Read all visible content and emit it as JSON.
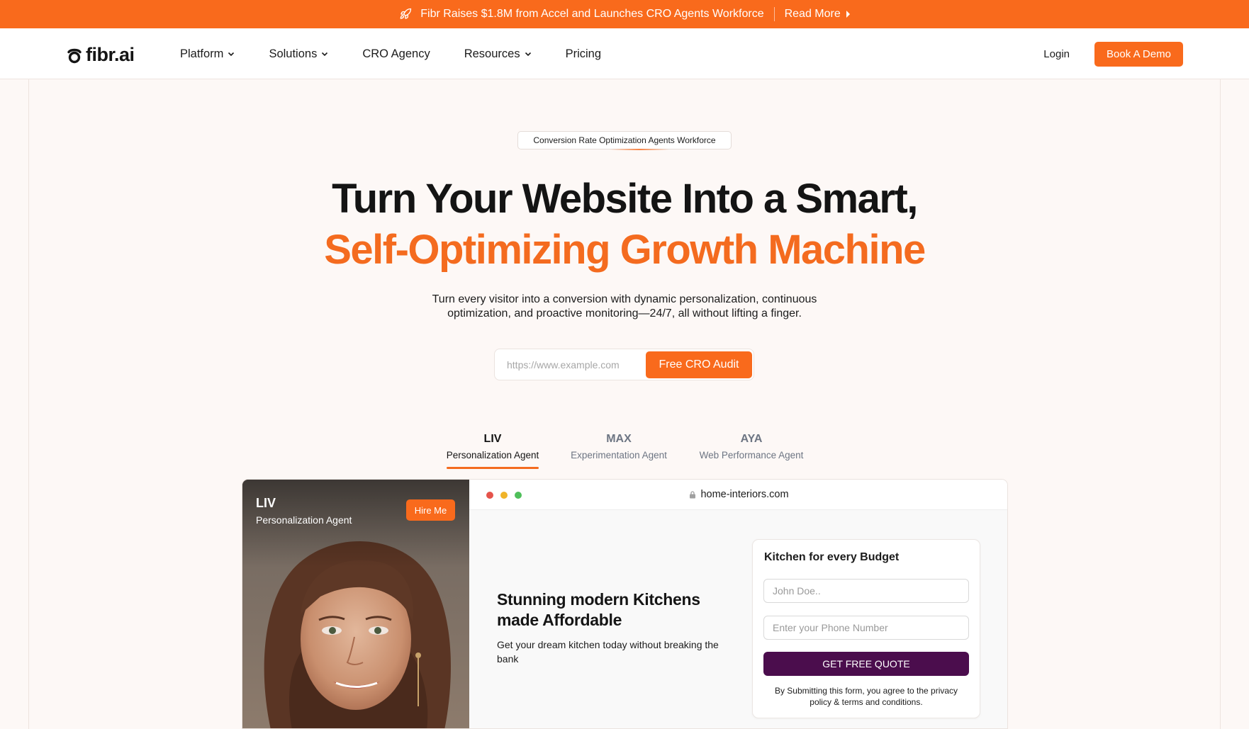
{
  "announcement": {
    "text": "Fibr Raises $1.8M from Accel and Launches CRO Agents Workforce",
    "link": "Read More",
    "icon": "rocket-icon"
  },
  "nav": {
    "logo": "fibr.ai",
    "items": [
      {
        "label": "Platform",
        "dropdown": true
      },
      {
        "label": "Solutions",
        "dropdown": true
      },
      {
        "label": "CRO Agency",
        "dropdown": false
      },
      {
        "label": "Resources",
        "dropdown": true
      },
      {
        "label": "Pricing",
        "dropdown": false
      }
    ],
    "login": "Login",
    "cta": "Book A Demo"
  },
  "hero": {
    "eyebrow": "Conversion Rate Optimization Agents Workforce",
    "headline_line1": "Turn Your Website Into a Smart,",
    "headline_line2": "Self-Optimizing Growth Machine",
    "subtext": "Turn every visitor into a conversion with dynamic personalization, continuous optimization, and proactive monitoring—24/7, all without lifting a finger.",
    "url_placeholder": "https://www.example.com",
    "audit_button": "Free CRO Audit"
  },
  "agents": {
    "tabs": [
      {
        "name": "LIV",
        "role": "Personalization Agent",
        "active": true
      },
      {
        "name": "MAX",
        "role": "Experimentation Agent",
        "active": false
      },
      {
        "name": "AYA",
        "role": "Web Performance Agent",
        "active": false
      }
    ]
  },
  "demo": {
    "agent_name": "LIV",
    "agent_role": "Personalization Agent",
    "hire_button": "Hire Me",
    "browser_url": "home-interiors.com",
    "window_dots": [
      "#e5534b",
      "#f0b429",
      "#4fbf5a"
    ],
    "page_title": "Stunning modern Kitchens made Affordable",
    "page_subtitle": "Get your dream kitchen today without breaking the bank",
    "form": {
      "title": "Kitchen for every Budget",
      "name_placeholder": "John Doe..",
      "phone_placeholder": "Enter your Phone Number",
      "submit": "GET FREE QUOTE",
      "legal": "By Submitting this form, you agree to the privacy policy & terms and conditions."
    }
  },
  "colors": {
    "brand_orange": "#f96a1c",
    "headline_orange": "#f46b1f",
    "quote_button": "#4b0d4d"
  }
}
